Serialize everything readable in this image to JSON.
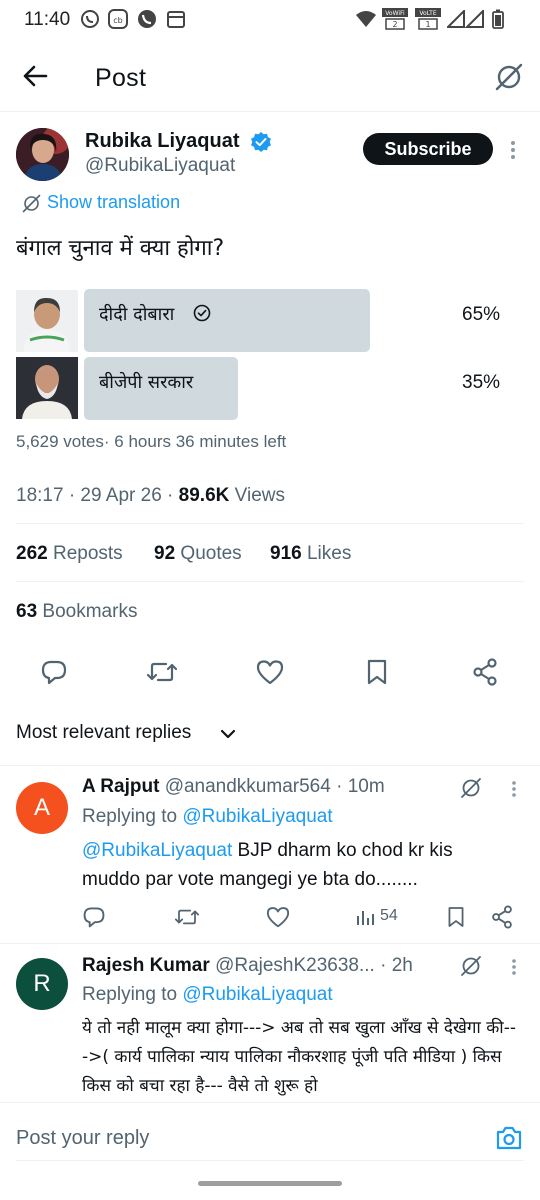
{
  "status_bar": {
    "time": "11:40",
    "net1": "VoWiFi",
    "net1_sub": "2",
    "net2": "VoLTE",
    "net2_sub": "1"
  },
  "header": {
    "title": "Post"
  },
  "post": {
    "author_name": "Rubika Liyaquat",
    "author_handle": "@RubikaLiyaquat",
    "subscribe_label": "Subscribe",
    "show_translation": "Show translation",
    "text": "बंगाल चुनाव में क्या होगा?",
    "poll": {
      "options": [
        {
          "label": "दीदी दोबारा",
          "percent_text": "65%",
          "percent": 65,
          "winner": true
        },
        {
          "label": "बीजेपी सरकार",
          "percent_text": "35%",
          "percent": 35,
          "winner": false
        }
      ],
      "meta": "5,629 votes· 6 hours 36 minutes left"
    },
    "time": "18:17 · 29 Apr 26 · ",
    "views_count": "89.6K",
    "views_label": " Views",
    "reposts_count": "262",
    "reposts_label": " Reposts",
    "quotes_count": "92",
    "quotes_label": " Quotes",
    "likes_count": "916",
    "likes_label": " Likes",
    "bookmarks_count": "63",
    "bookmarks_label": " Bookmarks"
  },
  "replies_filter": "Most relevant replies",
  "replies": [
    {
      "avatar_letter": "A",
      "avatar_color": "#f4511e",
      "name": "A Rajput",
      "handle": "@anandkkumar564",
      "time": "· 10m",
      "replying_to_label": "Replying to ",
      "replying_to": "@RubikaLiyaquat",
      "mention": "@RubikaLiyaquat",
      "text": " BJP dharm ko chod kr kis muddo par vote mangegi ye bta do........",
      "views": "54"
    },
    {
      "avatar_letter": "R",
      "avatar_color": "#0b4f3c",
      "name": "Rajesh Kumar",
      "handle": "@RajeshK23638...",
      "time": "· 2h",
      "replying_to_label": "Replying to ",
      "replying_to": "@RubikaLiyaquat",
      "text": "ये तो नही मालूम क्या होगा---> अब तो सब खुला आँख से देखेगा की--->(  कार्य पालिका न्याय पालिका नौकरशाह पूंजी पति मीडिया ) किस किस को बचा रहा है--- वैसे तो शुरू हो"
    }
  ],
  "compose": {
    "placeholder": "Post your reply"
  },
  "colors": {
    "accent": "#1d9bf0",
    "poll_bar": "#cfd9de",
    "text": "#0f1419",
    "secondary": "#536471"
  }
}
